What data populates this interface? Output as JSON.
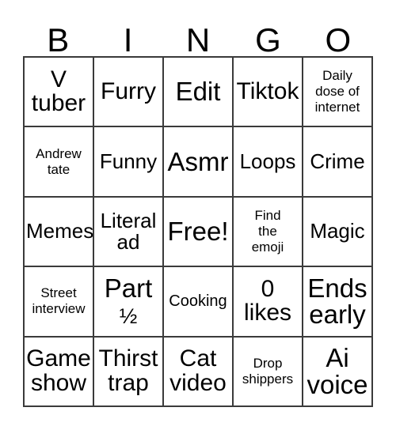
{
  "card": {
    "title_letters": [
      "B",
      "I",
      "N",
      "G",
      "O"
    ],
    "background_color": "#ffffff",
    "text_color": "#000000",
    "grid_line_color": "#3a3a3a",
    "columns": 5,
    "rows": 5,
    "free_space_label": "Free!",
    "cells": [
      {
        "text": "V\ntuber",
        "size": "lg",
        "row": 1,
        "col": 1
      },
      {
        "text": "Furry",
        "size": "lg",
        "row": 1,
        "col": 2
      },
      {
        "text": "Edit",
        "size": "xl",
        "row": 1,
        "col": 3
      },
      {
        "text": "Tiktok",
        "size": "lg",
        "row": 1,
        "col": 4
      },
      {
        "text": "Daily\ndose of\ninternet",
        "size": "xs",
        "row": 1,
        "col": 5
      },
      {
        "text": "Andrew\ntate",
        "size": "xs",
        "row": 2,
        "col": 1
      },
      {
        "text": "Funny",
        "size": "md",
        "row": 2,
        "col": 2
      },
      {
        "text": "Asmr",
        "size": "xl",
        "row": 2,
        "col": 3
      },
      {
        "text": "Loops",
        "size": "md",
        "row": 2,
        "col": 4
      },
      {
        "text": "Crime",
        "size": "md",
        "row": 2,
        "col": 5
      },
      {
        "text": "Memes",
        "size": "md",
        "row": 3,
        "col": 1
      },
      {
        "text": "Literal\nad",
        "size": "md",
        "row": 3,
        "col": 2
      },
      {
        "text": "Free!",
        "size": "xl",
        "row": 3,
        "col": 3
      },
      {
        "text": "Find\nthe\nemoji",
        "size": "xs",
        "row": 3,
        "col": 4
      },
      {
        "text": "Magic",
        "size": "md",
        "row": 3,
        "col": 5
      },
      {
        "text": "Street\ninterview",
        "size": "xs",
        "row": 4,
        "col": 1
      },
      {
        "text": "Part\n½",
        "size": "xl",
        "row": 4,
        "col": 2
      },
      {
        "text": "Cooking",
        "size": "sm",
        "row": 4,
        "col": 3
      },
      {
        "text": "0\nlikes",
        "size": "lg",
        "row": 4,
        "col": 4
      },
      {
        "text": "Ends\nearly",
        "size": "xl",
        "row": 4,
        "col": 5
      },
      {
        "text": "Game\nshow",
        "size": "lg",
        "row": 5,
        "col": 1
      },
      {
        "text": "Thirst\ntrap",
        "size": "lg",
        "row": 5,
        "col": 2
      },
      {
        "text": "Cat\nvideo",
        "size": "lg",
        "row": 5,
        "col": 3
      },
      {
        "text": "Drop\nshippers",
        "size": "xs",
        "row": 5,
        "col": 4
      },
      {
        "text": "Ai\nvoice",
        "size": "xl",
        "row": 5,
        "col": 5
      }
    ]
  }
}
